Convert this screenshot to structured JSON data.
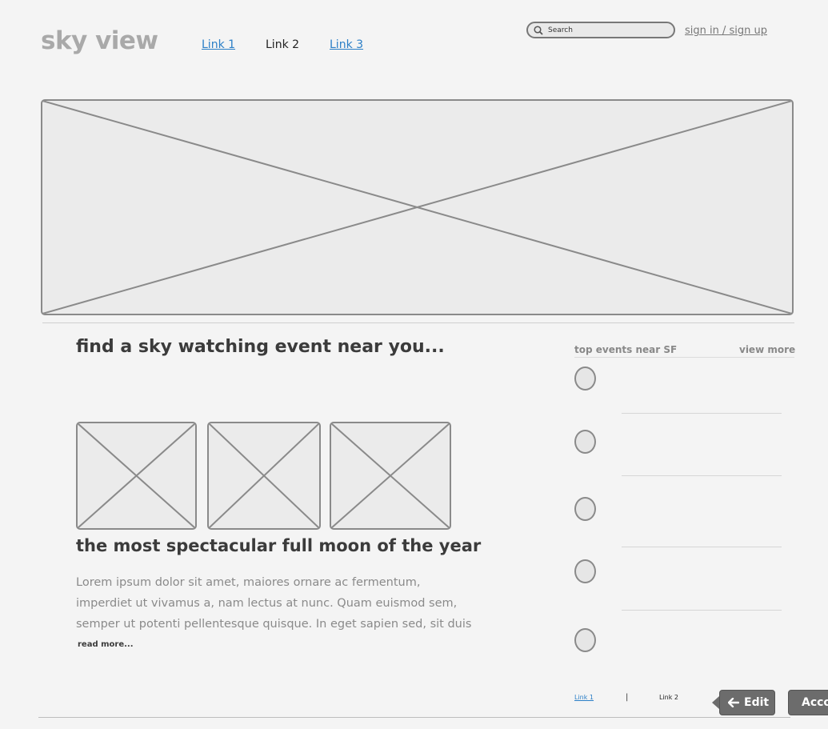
{
  "header": {
    "logo": "sky view",
    "nav": [
      "Link 1",
      "Link 2",
      "Link 3"
    ],
    "search_placeholder": "Search",
    "signin": "sign in / sign up"
  },
  "main": {
    "heading": "find a sky watching event near you...",
    "article_title": "the most spectacular full moon of the year",
    "article_body": "Lorem ipsum dolor sit amet, maiores ornare ac fermentum, imperdiet ut vivamus a, nam lectus at nunc. Quam euismod sem, semper ut potenti pellentesque quisque. In eget sapien sed, sit duis",
    "read_more": "read more..."
  },
  "sidebar": {
    "title": "top events near SF",
    "view_more": "view more"
  },
  "footer": {
    "links": [
      "Link 1",
      "Link 2"
    ],
    "separator": "|"
  },
  "toolbar": {
    "edit_label": "Edit",
    "account_label": "Account"
  },
  "icons": {
    "search": "search-icon",
    "back_arrow": "arrow-left-icon",
    "placeholder": "image-placeholder-icon"
  },
  "colors": {
    "link": "#2b7fc7",
    "background": "#f4f4f4",
    "button": "#6c6c6c"
  }
}
